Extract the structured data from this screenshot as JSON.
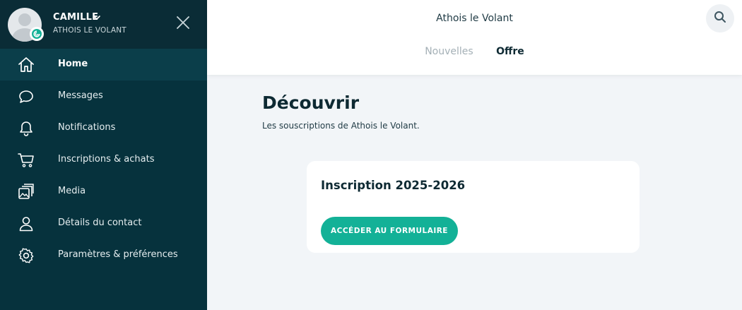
{
  "user": {
    "name": "CAMILLE",
    "organization": "ATHOIS LE VOLANT"
  },
  "sidebar": {
    "items": [
      {
        "label": "Home",
        "icon": "home-icon",
        "active": true
      },
      {
        "label": "Messages",
        "icon": "chat-bubble-icon",
        "active": false
      },
      {
        "label": "Notifications",
        "icon": "bell-icon",
        "active": false
      },
      {
        "label": "Inscriptions & achats",
        "icon": "cart-icon",
        "active": false
      },
      {
        "label": "Media",
        "icon": "images-icon",
        "active": false
      },
      {
        "label": "Détails du contact",
        "icon": "person-icon",
        "active": false
      },
      {
        "label": "Paramètres & préférences",
        "icon": "gear-icon",
        "active": false
      }
    ]
  },
  "header": {
    "title": "Athois le Volant",
    "tabs": [
      {
        "label": "Nouvelles",
        "active": false
      },
      {
        "label": "Offre",
        "active": true
      }
    ]
  },
  "main": {
    "title": "Découvrir",
    "subtitle": "Les souscriptions de Athois le Volant.",
    "card": {
      "title": "Inscription 2025-2026",
      "button_label": "ACCÉDER AU FORMULAIRE"
    }
  },
  "colors": {
    "sidebar_bg": "#06323d",
    "sidebar_active_bg": "#0b3e4a",
    "accent_green": "#13b197",
    "page_bg": "#f2f5f8"
  }
}
